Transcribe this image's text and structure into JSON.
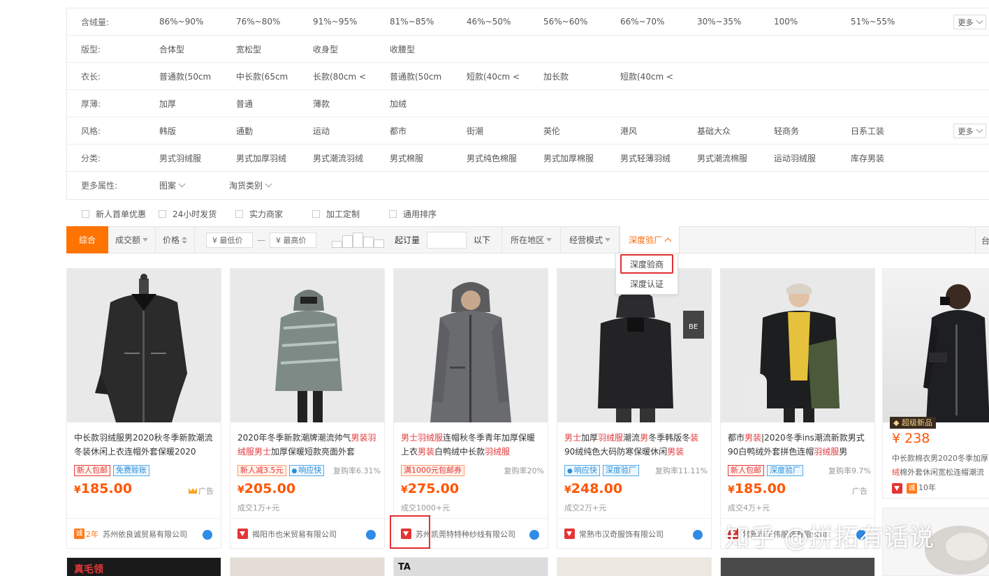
{
  "filters": {
    "rows": [
      {
        "label": "含绒量:",
        "values": [
          "86%~90%",
          "76%~80%",
          "91%~95%",
          "81%~85%",
          "46%~50%",
          "56%~60%",
          "66%~70%",
          "30%~35%",
          "100%",
          "51%~55%"
        ],
        "more": "更多"
      },
      {
        "label": "版型:",
        "values": [
          "合体型",
          "宽松型",
          "收身型",
          "收腰型"
        ]
      },
      {
        "label": "衣长:",
        "values": [
          "普通款(50cm",
          "中长款(65cm",
          "长款(80cm <",
          "普通款(50cm",
          "短款(40cm <",
          "加长款",
          "短款(40cm <"
        ]
      },
      {
        "label": "厚薄:",
        "values": [
          "加厚",
          "普通",
          "薄款",
          "加绒"
        ]
      },
      {
        "label": "风格:",
        "values": [
          "韩版",
          "通勤",
          "运动",
          "都市",
          "街潮",
          "英伦",
          "港风",
          "基础大众",
          "轻商务",
          "日系工装"
        ],
        "more": "更多"
      },
      {
        "label": "分类:",
        "values": [
          "男式羽绒服",
          "男式加厚羽绒",
          "男式潮流羽绒",
          "男式棉服",
          "男式纯色棉服",
          "男式加厚棉服",
          "男式轻薄羽绒",
          "男式潮流棉服",
          "运动羽绒服",
          "库存男装"
        ]
      }
    ],
    "more_attrs": {
      "label": "更多属性:",
      "values": [
        "图案",
        "淘货类别"
      ]
    }
  },
  "services": [
    "新人首单优惠",
    "24小时发货",
    "实力商家",
    "加工定制",
    "通用排序"
  ],
  "sortbar": {
    "overall": "综合",
    "volume": "成交额",
    "price": "价格",
    "min_price": "¥ 最低价",
    "dash": "—",
    "max_price": "¥ 最高价",
    "moq": "起订量",
    "below": "以下",
    "region": "所在地区",
    "mode": "经营模式",
    "deep": "深度验厂",
    "cut": "台"
  },
  "dropdown": [
    "深度验商",
    "深度认证"
  ],
  "products": [
    {
      "title_pre": "中长款羽绒服男2020秋冬季新款潮流冬装休闲上衣连帽外套保暖2020",
      "title_parts": [],
      "tags": [
        {
          "text": "新人包邮",
          "style": "red"
        },
        {
          "text": "免费赊账",
          "style": "blue"
        }
      ],
      "repurchase": "",
      "price": "185.00",
      "ad": "广告",
      "volume": "",
      "years": "2年",
      "store": "苏州依良诚贸易有限公司",
      "icon": "cheng"
    },
    {
      "title_html": [
        "2020年冬季新款潮牌潮流帅气",
        "男装羽绒服男士",
        "加厚保暖短款亮面外套"
      ],
      "tags": [
        {
          "text": "新人减3.5元",
          "style": "orange"
        },
        {
          "text": "响应快",
          "style": "blue"
        }
      ],
      "repurchase": "复购率6.31%",
      "price": "205.00",
      "ad": "",
      "volume": "成交1万+元",
      "store": "揭阳市也米贸易有限公司",
      "icon": "shield"
    },
    {
      "title_html": [
        "男士羽绒服",
        "连帽秋冬季青年加厚保暖上衣",
        "男装",
        "白鸭绒中长款",
        "羽绒服"
      ],
      "tags": [
        {
          "text": "满1000元包邮券",
          "style": "orange"
        }
      ],
      "repurchase": "复购率20%",
      "price": "275.00",
      "ad": "",
      "volume": "成交1000+元",
      "store": "苏州凯莞特特种纱线有限公司",
      "icon": "shield"
    },
    {
      "title_html": [
        "男士",
        "加厚",
        "羽绒服",
        "潮流",
        "男",
        "冬季韩版冬",
        "装",
        "90绒纯色大码防寒保暖休闲",
        "男装"
      ],
      "tags": [
        {
          "text": "响应快",
          "style": "blue"
        },
        {
          "text": "深度验厂",
          "style": "blue"
        }
      ],
      "repurchase": "复购率11.11%",
      "price": "248.00",
      "ad": "",
      "volume": "成交2万+元",
      "store": "常熟市汉奇服饰有限公司",
      "icon": "shield"
    },
    {
      "title_html": [
        "都市",
        "男装",
        "|2020冬季ins潮流新款男式90白鸭绒外套拼色连帽",
        "羽绒服",
        "男"
      ],
      "tags": [
        {
          "text": "新人包邮",
          "style": "red"
        },
        {
          "text": "深度验厂",
          "style": "blue"
        }
      ],
      "repurchase": "复购率9.7%",
      "price": "185.00",
      "ad": "广告",
      "volume": "成交4万+元",
      "store": "常熟市王伟服饰有限公司",
      "icon": "shield"
    }
  ],
  "product6": {
    "badge": "超级新品",
    "price": "¥ 238",
    "line1": "中长款棉衣男2020冬季加厚",
    "line2_hl": "绒",
    "line2": "棉外套休闲宽松连帽潮流",
    "years": "10年"
  },
  "bottom": {
    "tag": "真毛领",
    "tag2": "TA"
  },
  "watermark": "知乎 @拼拓有话说",
  "colors": {
    "accent": "#ff7300",
    "price": "#ff5500",
    "highlight": "#e03030",
    "link_blue": "#2f8be6"
  }
}
